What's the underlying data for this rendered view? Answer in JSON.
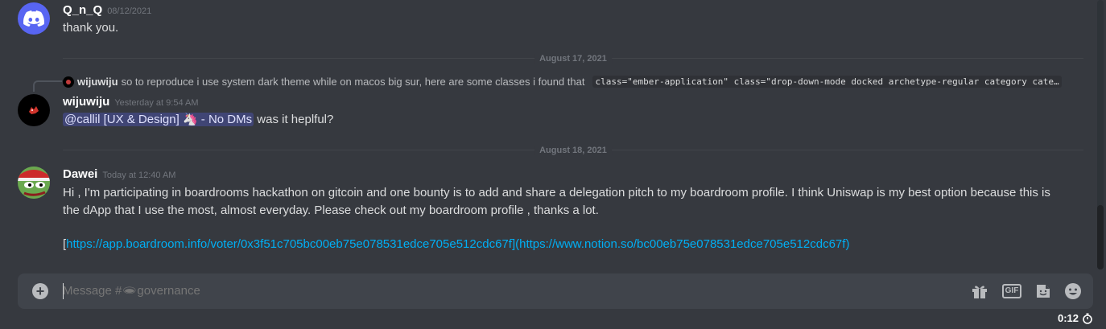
{
  "messages": [
    {
      "author": "Q_n_Q",
      "timestamp": "08/12/2021",
      "text": "thank you.",
      "avatar": "discord-logo-icon"
    },
    {
      "divider": "August 17, 2021"
    },
    {
      "reply": {
        "author": "wijuwiju",
        "text": "so to reproduce i use system dark theme while on macos big sur, here are some classes i found that",
        "code": "class=\"ember-application\" class=\"drop-down-mode docked archetype-regular category cate…"
      },
      "author": "wijuwiju",
      "timestamp": "Yesterday at 9:54 AM",
      "mention": "@callil [UX & Design] 🦄 - No DMs",
      "text": "was it heplful?",
      "avatar": "red-creature-icon"
    },
    {
      "divider": "August 18, 2021"
    },
    {
      "author": "Dawei",
      "timestamp": "Today at 12:40 AM",
      "line1": "Hi , I'm participating in boardrooms hackathon on gitcoin and one bounty is to add and share a delegation pitch to my boardroom profile. I think Uniswap is my best option because this is",
      "line2": "the dApp that I use the most, almost everyday. Please check out my boardroom profile , thanks a lot.",
      "bracket_open": "[",
      "link1": "https://app.boardroom.info/voter/0x3f51c705bc00eb75e078531edce705e512cdc67f",
      "link_mid": "](",
      "link2": "https://www.notion.so/bc00eb75e078531edce705e512cdc67f",
      "bracket_close": ")",
      "avatar": "pepe-santa-hat-icon"
    }
  ],
  "composer": {
    "placeholder": "Message #🕳governance",
    "icons": [
      "add-icon",
      "gift-icon",
      "gif-icon",
      "sticker-icon",
      "emoji-icon"
    ],
    "gif_label": "GIF"
  },
  "timer": "0:12",
  "colors": {
    "background": "#36393f",
    "input": "#40444b",
    "link": "#00aff4",
    "mention_bg": "#4e57a8",
    "brand": "#5865f2"
  }
}
